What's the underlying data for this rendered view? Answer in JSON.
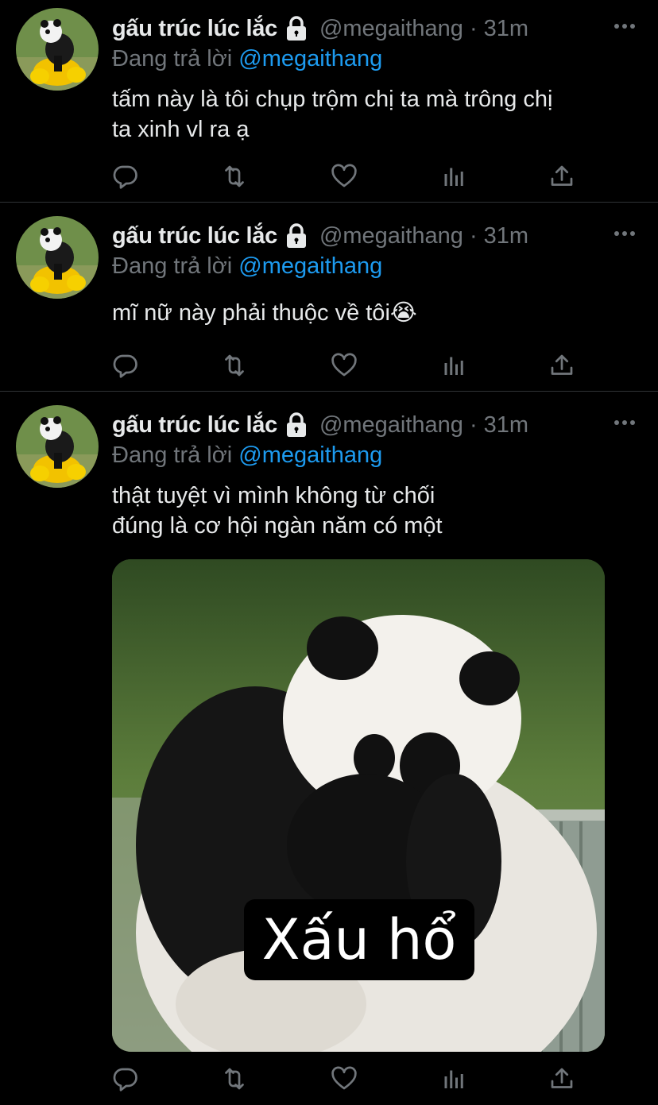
{
  "tweets": [
    {
      "display_name": "gấu trúc lúc lắc",
      "handle": "@megaithang",
      "separator": "·",
      "time": "31m",
      "reply_prefix": "Đang trả lời",
      "reply_to": "@megaithang",
      "text": "tấm này là tôi chụp trộm chị ta mà trông chị\nta xinh vl ra ạ"
    },
    {
      "display_name": "gấu trúc lúc lắc",
      "handle": "@megaithang",
      "separator": "·",
      "time": "31m",
      "reply_prefix": "Đang trả lời",
      "reply_to": "@megaithang",
      "text": "mĩ nữ này phải thuộc về tôi😭"
    },
    {
      "display_name": "gấu trúc lúc lắc",
      "handle": "@megaithang",
      "separator": "·",
      "time": "31m",
      "reply_prefix": "Đang trả lời",
      "reply_to": "@megaithang",
      "text": "thật tuyệt vì mình không từ chối\nđúng là cơ hội ngàn năm có một",
      "media_caption": "Xấu hổ"
    }
  ],
  "icons": {
    "avatar": "panda-avatar",
    "lock": "lock-icon",
    "more": "more-icon",
    "reply": "reply-icon",
    "retweet": "retweet-icon",
    "like": "like-icon",
    "analytics": "analytics-icon",
    "share": "share-icon"
  },
  "colors": {
    "background": "#000000",
    "text": "#e7e9ea",
    "muted": "#71767b",
    "link": "#1d9bf0",
    "divider": "#2f3336"
  }
}
